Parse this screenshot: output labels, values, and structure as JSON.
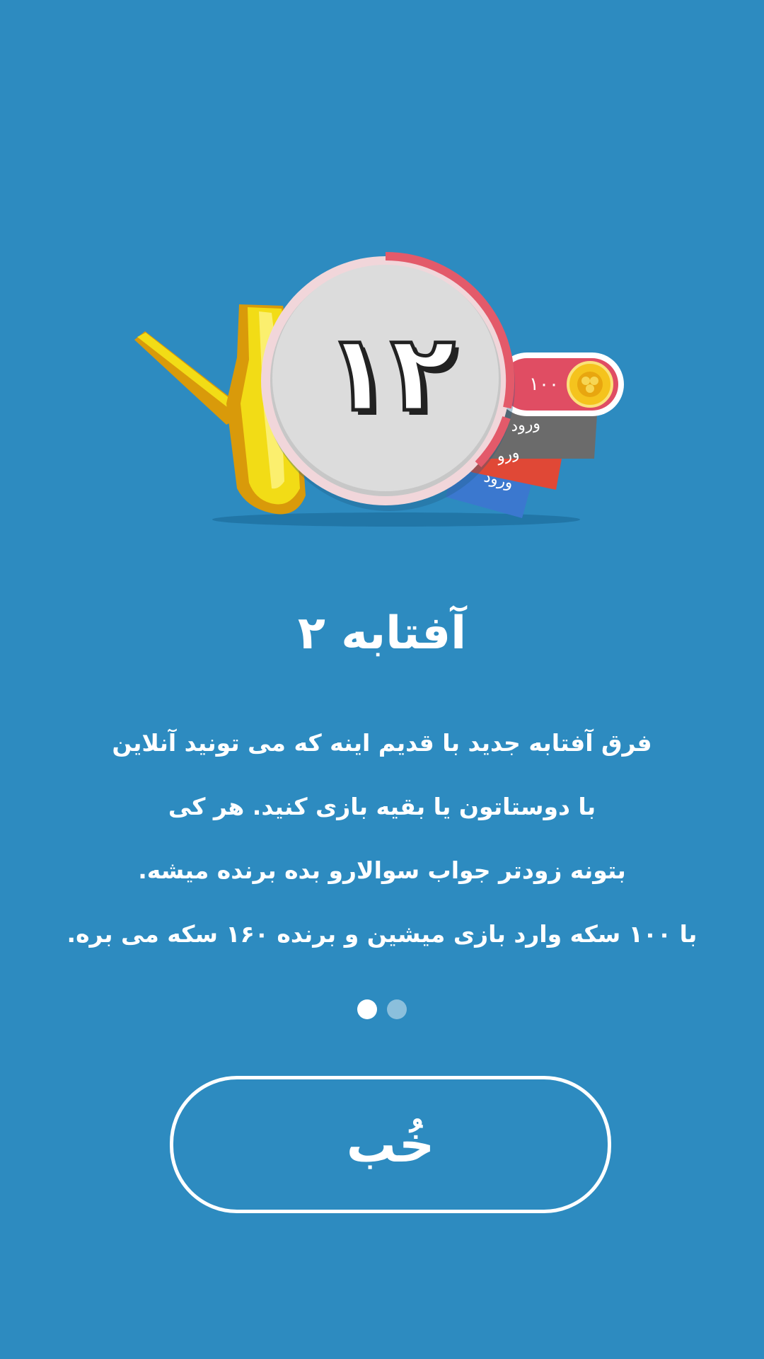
{
  "illustration": {
    "timer_number": "۱۲",
    "coin_pill_value": "۱۰۰",
    "entry_card_labels": [
      "ورود",
      "ورو",
      "ورود"
    ],
    "colors": {
      "background": "#2d8bc0",
      "timer_ring": "#e35a6a",
      "coin_pill": "#e04d63",
      "coin": "#f5c31d",
      "card_gray": "#6b6b6b",
      "card_red": "#e04836",
      "card_blue": "#3b78cf",
      "pitcher": "#f2dc16"
    },
    "icons": [
      "pitcher-icon",
      "timer-icon",
      "coin-icon"
    ]
  },
  "title": "آفتابه ۲",
  "description_lines": [
    "فرق آفتابه جدید با قدیم اینه که می تونید آنلاین",
    "با دوستاتون یا بقیه بازی کنید. هر کی",
    "بتونه زودتر جواب سوالارو بده برنده میشه.",
    "با ۱۰۰ سکه وارد بازی میشین و برنده ۱۶۰ سکه می بره."
  ],
  "pager": {
    "total": 2,
    "active_index": 0
  },
  "ok_button_label": "خُب"
}
